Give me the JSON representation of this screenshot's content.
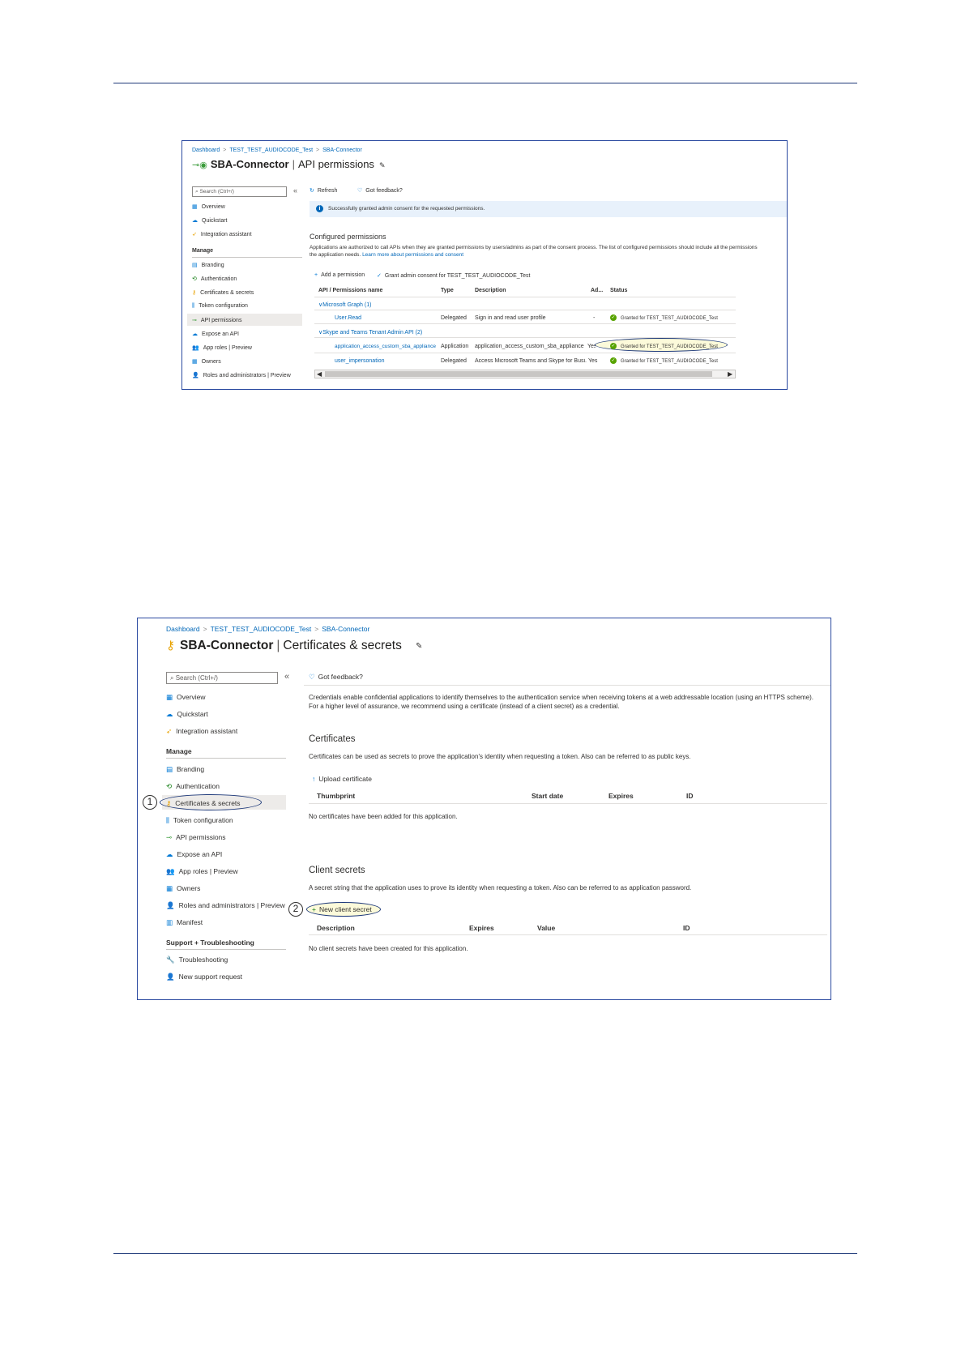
{
  "shot1": {
    "breadcrumb": [
      "Dashboard",
      "TEST_TEST_AUDIOCODE_Test",
      "SBA-Connector"
    ],
    "title_app": "SBA-Connector",
    "title_page": "API permissions",
    "search_placeholder": "Search (Ctrl+/)",
    "collapse": "«",
    "nav": {
      "overview": "Overview",
      "quickstart": "Quickstart",
      "integration": "Integration assistant",
      "manage_header": "Manage",
      "branding": "Branding",
      "authentication": "Authentication",
      "certificates": "Certificates & secrets",
      "token": "Token configuration",
      "api_permissions": "API permissions",
      "expose": "Expose an API",
      "app_roles": "App roles | Preview",
      "owners": "Owners",
      "roles_admins": "Roles and administrators | Preview"
    },
    "toolbar": {
      "refresh": "Refresh",
      "feedback": "Got feedback?"
    },
    "banner": "Successfully granted admin consent for the requested permissions.",
    "section_title": "Configured permissions",
    "description": "Applications are authorized to call APIs when they are granted permissions by users/admins as part of the consent process. The list of configured permissions should include all the permissions the application needs.",
    "description_link": "Learn more about permissions and consent",
    "actions": {
      "add": "Add a permission",
      "grant": "Grant admin consent for TEST_TEST_AUDIOCODE_Test"
    },
    "table": {
      "headers": [
        "API / Permissions name",
        "Type",
        "Description",
        "Ad...",
        "Status"
      ],
      "group1": "Microsoft Graph (1)",
      "group2": "Skype and Teams Tenant Admin API (2)",
      "rows": [
        {
          "name": "User.Read",
          "type": "Delegated",
          "description": "Sign in and read user profile",
          "admin": "-",
          "status": "Granted for TEST_TEST_AUDIOCODE_Test"
        },
        {
          "name": "application_access_custom_sba_appliance",
          "type": "Application",
          "description": "application_access_custom_sba_appliance",
          "admin": "Yes",
          "status": "Granted for TEST_TEST_AUDIOCODE_Test"
        },
        {
          "name": "user_impersonation",
          "type": "Delegated",
          "description": "Access Microsoft Teams and Skype for Busi...",
          "admin": "Yes",
          "status": "Granted for TEST_TEST_AUDIOCODE_Test"
        }
      ]
    }
  },
  "shot2": {
    "breadcrumb": [
      "Dashboard",
      "TEST_TEST_AUDIOCODE_Test",
      "SBA-Connector"
    ],
    "title_app": "SBA-Connector",
    "title_page": "Certificates & secrets",
    "search_placeholder": "Search (Ctrl+/)",
    "collapse": "«",
    "nav": {
      "overview": "Overview",
      "quickstart": "Quickstart",
      "integration": "Integration assistant",
      "manage_header": "Manage",
      "branding": "Branding",
      "authentication": "Authentication",
      "certificates": "Certificates & secrets",
      "token": "Token configuration",
      "api_permissions": "API permissions",
      "expose": "Expose an API",
      "app_roles": "App roles | Preview",
      "owners": "Owners",
      "roles_admins": "Roles and administrators | Preview",
      "manifest": "Manifest",
      "support_header": "Support + Troubleshooting",
      "troubleshooting": "Troubleshooting",
      "new_support": "New support request"
    },
    "toolbar": {
      "feedback": "Got feedback?"
    },
    "intro": "Credentials enable confidential applications to identify themselves to the authentication service when receiving tokens at a web addressable location (using an HTTPS scheme). For a higher level of assurance, we recommend using a certificate (instead of a client secret) as a credential.",
    "certificates": {
      "title": "Certificates",
      "description": "Certificates can be used as secrets to prove the application's identity when requesting a token. Also can be referred to as public keys.",
      "upload": "Upload certificate",
      "headers": [
        "Thumbprint",
        "Start date",
        "Expires",
        "ID"
      ],
      "empty": "No certificates have been added for this application."
    },
    "secrets": {
      "title": "Client secrets",
      "description": "A secret string that the application uses to prove its identity when requesting a token. Also can be referred to as application password.",
      "new_button": "New client secret",
      "headers": [
        "Description",
        "Expires",
        "Value",
        "ID"
      ],
      "empty": "No client secrets have been created for this application."
    },
    "markers": [
      "1",
      "2"
    ]
  }
}
